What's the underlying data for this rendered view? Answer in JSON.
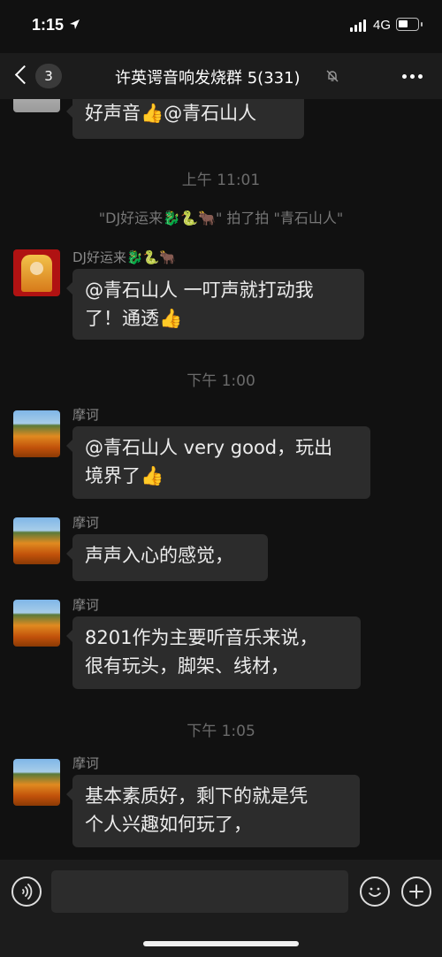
{
  "status_bar": {
    "time": "1:15",
    "network": "4G"
  },
  "nav": {
    "back_count": "3",
    "title": "许英谔音响发烧群 5(331)"
  },
  "messages": {
    "m0": {
      "text": "好声音👍@青石山人"
    },
    "t1": "上午 11:01",
    "sys1": "\"DJ好运来🐉🐍🐂\" 拍了拍 \"青石山人\"",
    "m1": {
      "sender": "DJ好运来🐉🐍🐂",
      "line1": "@青石山人 一叮声就打动我",
      "line2": "了！通透👍"
    },
    "t2": "下午 1:00",
    "m2": {
      "sender": "摩诃",
      "line1": "@青石山人 very good，玩出",
      "line2": "境界了👍"
    },
    "m3": {
      "sender": "摩诃",
      "text": "声声入心的感觉，"
    },
    "m4": {
      "sender": "摩诃",
      "line1": "8201作为主要听音乐来说，",
      "line2": "很有玩头，脚架、线材，"
    },
    "t3": "下午 1:05",
    "m5": {
      "sender": "摩诃",
      "line1": "基本素质好，剩下的就是凭",
      "line2": "个人兴趣如何玩了，"
    }
  },
  "icons": {
    "location": "location-arrow-icon",
    "back": "chevron-left-icon",
    "mute": "bell-slash-icon",
    "more": "ellipsis-icon",
    "voice": "voice-icon",
    "emoji": "emoji-icon",
    "plus": "plus-icon"
  }
}
